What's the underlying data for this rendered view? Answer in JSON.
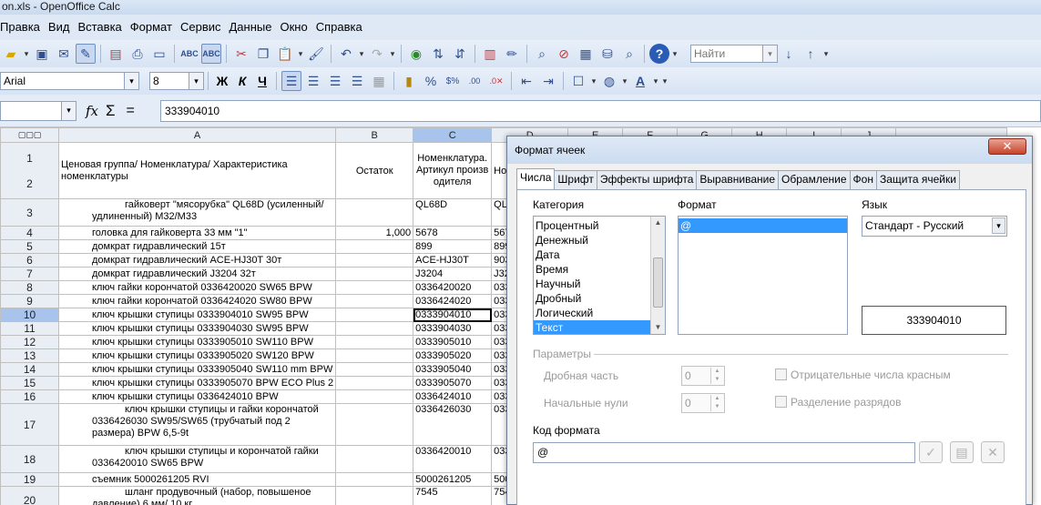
{
  "window": {
    "title": "on.xls - OpenOffice Calc"
  },
  "menu": [
    "Правка",
    "Вид",
    "Вставка",
    "Формат",
    "Сервис",
    "Данные",
    "Окно",
    "Справка"
  ],
  "toolbar": {
    "find_placeholder": "Найти"
  },
  "format_toolbar": {
    "font": "Arial",
    "size": "8",
    "bold": "Ж",
    "italic": "К",
    "underline": "Ч"
  },
  "formula_bar": {
    "name_box": "",
    "fx": "fx",
    "sigma": "Σ",
    "equals": "=",
    "content": "333904010"
  },
  "sheet": {
    "columns": [
      "A",
      "B",
      "C",
      "D",
      "E",
      "F",
      "G",
      "H",
      "I",
      "J"
    ],
    "header": {
      "a": "Ценовая группа/ Номенклатура/ Характеристика номенклатуры",
      "b": "Остаток",
      "c": "Номенклатура.Артикул производителя",
      "d": "Но а"
    },
    "rows": [
      {
        "n": "3",
        "a": "гайковерт \"мясорубка\" QL68D (усиленный/удлиненный) M32/M33",
        "b": "",
        "c": "QL68D",
        "d": "QL6"
      },
      {
        "n": "4",
        "a": "головка для гайковерта 33 мм \"1\"",
        "b": "1,000",
        "c": "5678",
        "d": "567"
      },
      {
        "n": "5",
        "a": "домкрат гидравлический 15т",
        "b": "",
        "c": "899",
        "d": "899"
      },
      {
        "n": "6",
        "a": "домкрат гидравлический ACE-HJ30T 30т",
        "b": "",
        "c": "ACE-HJ30T",
        "d": "903"
      },
      {
        "n": "7",
        "a": "домкрат гидравлический J3204 32т",
        "b": "",
        "c": "J3204",
        "d": "J32"
      },
      {
        "n": "8",
        "a": "ключ гайки корончатой 0336420020 SW65 BPW",
        "b": "",
        "c": "0336420020",
        "d": "033"
      },
      {
        "n": "9",
        "a": "ключ гайки корончатой 0336424020 SW80 BPW",
        "b": "",
        "c": "0336424020",
        "d": "033"
      },
      {
        "n": "10",
        "a": "ключ крышки ступицы 0333904010 SW95 BPW",
        "b": "",
        "c": "0333904010",
        "d": "033"
      },
      {
        "n": "11",
        "a": "ключ крышки ступицы 0333904030 SW95 BPW",
        "b": "",
        "c": "0333904030",
        "d": "033"
      },
      {
        "n": "12",
        "a": "ключ крышки ступицы 0333905010 SW110 BPW",
        "b": "",
        "c": "0333905010",
        "d": "033"
      },
      {
        "n": "13",
        "a": "ключ крышки ступицы 0333905020 SW120 BPW",
        "b": "",
        "c": "0333905020",
        "d": "033"
      },
      {
        "n": "14",
        "a": "ключ крышки ступицы 0333905040 SW110 mm BPW",
        "b": "",
        "c": "0333905040",
        "d": "033"
      },
      {
        "n": "15",
        "a": "ключ крышки ступицы 0333905070 BPW ECO Plus 2",
        "b": "",
        "c": "0333905070",
        "d": "033"
      },
      {
        "n": "16",
        "a": "ключ крышки ступицы 0336424010 BPW",
        "b": "",
        "c": "0336424010",
        "d": "033"
      },
      {
        "n": "17",
        "a": "ключ крышки ступицы и гайки корончатой 0336426030 SW95/SW65 (трубчатый под 2 размера) BPW 6,5-9t",
        "b": "",
        "c": "0336426030",
        "d": "033"
      },
      {
        "n": "18",
        "a": "ключ крышки ступицы и корончатой гайки 0336420010 SW65 BPW",
        "b": "",
        "c": "0336420010",
        "d": "033"
      },
      {
        "n": "19",
        "a": "съемник 5000261205 RVI",
        "b": "",
        "c": "5000261205",
        "d": "500"
      },
      {
        "n": "20",
        "a": "шланг продувочный (набор, повышеное давление) 6 мм/ 10 кг",
        "b": "",
        "c": "7545",
        "d": "754"
      }
    ]
  },
  "dialog": {
    "title": "Формат ячеек",
    "close": "✕",
    "tabs": [
      "Числа",
      "Шрифт",
      "Эффекты шрифта",
      "Выравнивание",
      "Обрамление",
      "Фон",
      "Защита ячейки"
    ],
    "category_label": "Категория",
    "categories": [
      "Процентный",
      "Денежный",
      "Дата",
      "Время",
      "Научный",
      "Дробный",
      "Логический",
      "Текст"
    ],
    "selected_category": "Текст",
    "format_label": "Формат",
    "formats": [
      "@"
    ],
    "language_label": "Язык",
    "language": "Стандарт - Русский",
    "preview": "333904010",
    "params_label": "Параметры",
    "decimals_label": "Дробная часть",
    "decimals_value": "0",
    "leading_zeros_label": "Начальные нули",
    "leading_zeros_value": "0",
    "negative_red_label": "Отрицательные числа красным",
    "thousands_sep_label": "Разделение разрядов",
    "format_code_label": "Код формата",
    "format_code": "@"
  }
}
